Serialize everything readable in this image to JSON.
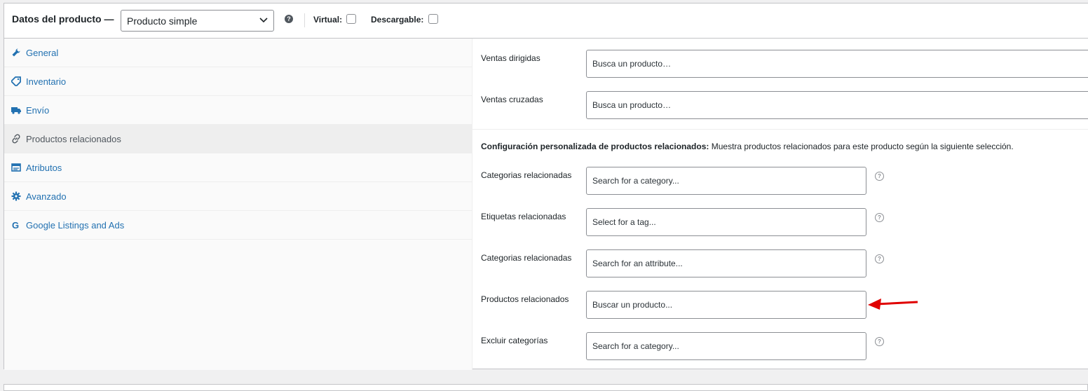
{
  "header": {
    "title": "Datos del producto —",
    "product_type": "Producto simple",
    "help_icon": "question-circle-icon",
    "virtual_label": "Virtual:",
    "downloadable_label": "Descargable:"
  },
  "tabs": [
    {
      "label": "General",
      "icon": "wrench-icon"
    },
    {
      "label": "Inventario",
      "icon": "tag-icon"
    },
    {
      "label": "Envío",
      "icon": "truck-icon"
    },
    {
      "label": "Productos relacionados",
      "icon": "link-icon",
      "active": true
    },
    {
      "label": "Atributos",
      "icon": "table-icon"
    },
    {
      "label": "Avanzado",
      "icon": "gear-icon"
    },
    {
      "label": "Google Listings and Ads",
      "icon": "google-icon"
    }
  ],
  "linked": {
    "upsells": {
      "label": "Ventas dirigidas",
      "placeholder": "Busca un producto…"
    },
    "crosssells": {
      "label": "Ventas cruzadas",
      "placeholder": "Busca un producto…"
    }
  },
  "config": {
    "title": "Configuración personalizada de productos relacionados:",
    "description": "Muestra productos relacionados para este producto según la siguiente selección."
  },
  "custom_fields": [
    {
      "label": "Categorias relacionadas",
      "placeholder": "Search for a category..."
    },
    {
      "label": "Etiquetas relacionadas",
      "placeholder": "Select for a tag..."
    },
    {
      "label": "Categorias relacionadas",
      "placeholder": "Search for an attribute..."
    },
    {
      "label": "Productos relacionados",
      "placeholder": "Buscar un producto..."
    },
    {
      "label": "Excluir categorías",
      "placeholder": "Search for a category..."
    }
  ],
  "colors": {
    "link": "#2271b1",
    "arrow": "#e00000"
  }
}
